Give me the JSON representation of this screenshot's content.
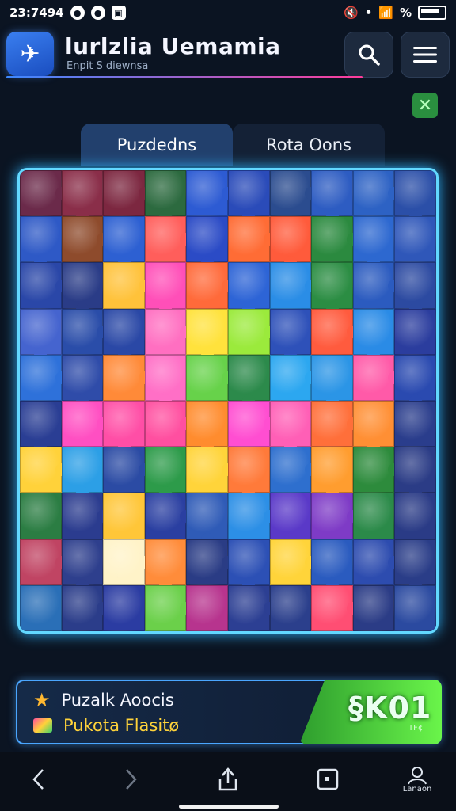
{
  "status_bar": {
    "time": "23:7494",
    "wifi": "•",
    "percent": "%"
  },
  "header": {
    "title": "lurlzlia Uemamia",
    "subtitle": "Enpit S diewnsa"
  },
  "tabs": [
    {
      "label": "Puzdedns"
    },
    {
      "label": "Rota Oons"
    }
  ],
  "board": {
    "rows": 10,
    "cols": 10,
    "colors": [
      [
        "#6b2a4a",
        "#8a2e49",
        "#7c2740",
        "#2c6a3f",
        "#2d5bd3",
        "#2a4bb9",
        "#2b4c8f",
        "#2d5cc2",
        "#2d62c4",
        "#2b4fa8"
      ],
      [
        "#2e59c6",
        "#8e4b2c",
        "#2d60d2",
        "#ff5e5b",
        "#2b4bc6",
        "#ff6c35",
        "#ff5b3b",
        "#2b8a3f",
        "#2d68d0",
        "#2f57b9"
      ],
      [
        "#2a47a8",
        "#2a3c87",
        "#ffc23a",
        "#ff4fb8",
        "#ff6a3a",
        "#2d64d6",
        "#2a8de6",
        "#2b8d43",
        "#2b5bbf",
        "#2c4aa1"
      ],
      [
        "#4564cf",
        "#2a4da9",
        "#2a48a6",
        "#ff6fc1",
        "#ffe23c",
        "#9bea3c",
        "#2e51b9",
        "#ff5b3e",
        "#2a8be6",
        "#2b3d9e"
      ],
      [
        "#2e71da",
        "#2f4ca9",
        "#ff8a38",
        "#ff6fc6",
        "#67d24a",
        "#2c8a4b",
        "#2ca7f0",
        "#2b95e6",
        "#ff5aa8",
        "#2a4ab0"
      ],
      [
        "#2a3e94",
        "#ff4fc2",
        "#ff4ea6",
        "#ff4fa0",
        "#ff8c2e",
        "#ff4ed1",
        "#ff5fb6",
        "#ff6f3a",
        "#ff8f34",
        "#2a3d8c"
      ],
      [
        "#ffd23a",
        "#2c9fe6",
        "#2b4ba4",
        "#2d9b4a",
        "#ffd43a",
        "#ff7a3a",
        "#2e6fce",
        "#ff9d2f",
        "#2d8b3c",
        "#2b3c86"
      ],
      [
        "#2b7d43",
        "#2b3c8f",
        "#ffc638",
        "#2a3fa1",
        "#2f5bb7",
        "#2c8fe6",
        "#5a39c8",
        "#7e3bc6",
        "#2b8a49",
        "#2a3b86"
      ],
      [
        "#c04463",
        "#2e3f8d",
        "#fff3c8",
        "#ff8c3a",
        "#2a3c85",
        "#2c50b5",
        "#ffd43a",
        "#2a5bbf",
        "#2d4caf",
        "#2a3d88"
      ],
      [
        "#2a6fb7",
        "#2b3d8a",
        "#2b3ca2",
        "#6bd04a",
        "#b7348e",
        "#2c3f93",
        "#2b3f8c",
        "#ff4e73",
        "#2b3c86",
        "#2b4aa0"
      ]
    ]
  },
  "footer": {
    "row1_label": "Puzalk Aoocis",
    "row2_label": "Pukota Flasitø"
  },
  "cta": {
    "label": "§K01",
    "sub": "TF¢"
  },
  "nav": {
    "profile_label": "Lanaon"
  }
}
